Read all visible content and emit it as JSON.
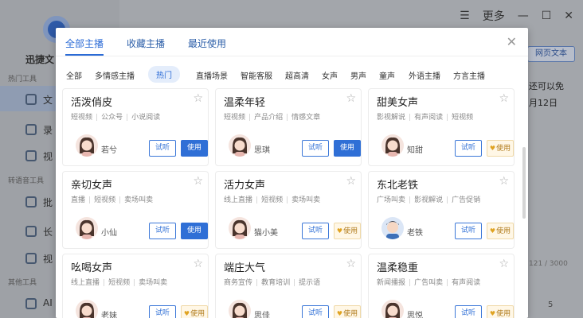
{
  "background": {
    "app_name": "迅捷文",
    "sections": [
      "热门工具",
      "转语音工具",
      "其他工具"
    ],
    "sidebar_items": [
      "文",
      "录",
      "视",
      "批",
      "长",
      "视",
      "AI"
    ],
    "window": {
      "more_label": "更多",
      "menu_icon": "menu-icon",
      "min_icon": "minimize-icon",
      "max_icon": "maximize-icon",
      "close_icon": "close-icon"
    },
    "web_text_button": "网页文本",
    "text_line1": "还可以免",
    "text_line2": "月12日",
    "char_count": "121 / 3000",
    "page_num": "5"
  },
  "dialog": {
    "tabs": [
      {
        "label": "全部主播",
        "active": true
      },
      {
        "label": "收藏主播",
        "active": false
      },
      {
        "label": "最近使用",
        "active": false
      }
    ],
    "close_label": "✕",
    "filters": [
      {
        "label": "全部",
        "active": false
      },
      {
        "label": "多情感主播",
        "active": false
      },
      {
        "label": "热门",
        "active": true
      },
      {
        "label": "直播场景",
        "active": false
      },
      {
        "label": "智能客服",
        "active": false
      },
      {
        "label": "超高清",
        "active": false
      },
      {
        "label": "女声",
        "active": false
      },
      {
        "label": "男声",
        "active": false
      },
      {
        "label": "童声",
        "active": false
      },
      {
        "label": "外语主播",
        "active": false
      },
      {
        "label": "方言主播",
        "active": false
      }
    ],
    "listen_label": "试听",
    "use_label": "使用",
    "cards": [
      {
        "name": "活泼俏皮",
        "tags": [
          "短视频",
          "公众号",
          "小说阅读"
        ],
        "voice": "若兮",
        "use_style": "blue",
        "avatar": "f"
      },
      {
        "name": "温柔年轻",
        "tags": [
          "短视频",
          "产品介绍",
          "情感文章"
        ],
        "voice": "思琪",
        "use_style": "blue",
        "avatar": "f"
      },
      {
        "name": "甜美女声",
        "tags": [
          "影视解说",
          "有声阅读",
          "短视频"
        ],
        "voice": "知甜",
        "use_style": "vip",
        "avatar": "f"
      },
      {
        "name": "亲切女声",
        "tags": [
          "直播",
          "短视频",
          "卖场叫卖"
        ],
        "voice": "小仙",
        "use_style": "blue",
        "avatar": "f"
      },
      {
        "name": "活力女声",
        "tags": [
          "线上直播",
          "短视频",
          "卖场叫卖"
        ],
        "voice": "猫小美",
        "use_style": "vip",
        "avatar": "f"
      },
      {
        "name": "东北老铁",
        "tags": [
          "广场叫卖",
          "影视解说",
          "广告促销"
        ],
        "voice": "老铁",
        "use_style": "vip",
        "avatar": "m"
      },
      {
        "name": "吆喝女声",
        "tags": [
          "线上直播",
          "短视频",
          "卖场叫卖"
        ],
        "voice": "老妹",
        "use_style": "vip",
        "avatar": "f"
      },
      {
        "name": "端庄大气",
        "tags": [
          "商务宣传",
          "教育培训",
          "提示语"
        ],
        "voice": "思佳",
        "use_style": "vip",
        "avatar": "f"
      },
      {
        "name": "温柔稳重",
        "tags": [
          "新闻播报",
          "广告叫卖",
          "有声阅读"
        ],
        "voice": "思悦",
        "use_style": "vip",
        "avatar": "f"
      }
    ]
  }
}
